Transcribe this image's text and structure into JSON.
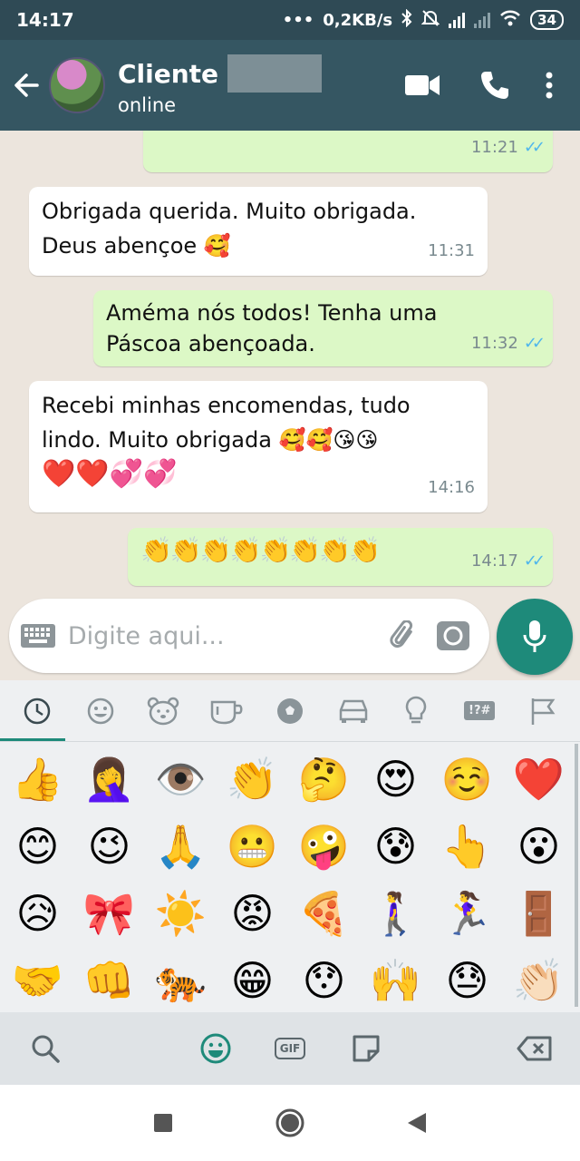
{
  "status_bar": {
    "time": "14:17",
    "network_speed": "0,2KB/s",
    "battery": "34"
  },
  "header": {
    "contact_name": "Cliente",
    "contact_status": "online"
  },
  "messages": [
    {
      "direction": "out",
      "text": "",
      "time": "11:21",
      "read": true
    },
    {
      "direction": "in",
      "text": "Obrigada querida. Muito obrigada.",
      "text2": "Deus abençoe 🥰",
      "time": "11:31"
    },
    {
      "direction": "out",
      "text": "Améma nós todos! Tenha uma",
      "text2": "Páscoa abençoada.",
      "time": "11:32",
      "read": true
    },
    {
      "direction": "in",
      "text": "Recebi minhas encomendas,  tudo",
      "text2": "lindo.  Muito obrigada 🥰🥰😘😘",
      "text3": "❤️❤️💞💞",
      "time": "14:16"
    },
    {
      "direction": "out",
      "text": "👏👏👏👏👏👏👏👏",
      "time": "14:17",
      "read": true
    }
  ],
  "composer": {
    "placeholder": "Digite aqui..."
  },
  "emoji_keyboard": {
    "categories": [
      "recent-icon",
      "smiley-icon",
      "animal-icon",
      "cup-icon",
      "ball-icon",
      "car-icon",
      "bulb-icon",
      "symbols-icon",
      "flag-icon"
    ],
    "symbols_label": "!?#",
    "recent_emojis": [
      "👍",
      "🤦‍♀️",
      "👁️",
      "👏",
      "🤔",
      "😍",
      "☺️",
      "❤️",
      "😊",
      "😉",
      "🙏",
      "😬",
      "🤪",
      "😰",
      "👆",
      "😮",
      "😥",
      "🎀",
      "☀️",
      "😡",
      "🍕",
      "🚶‍♀️",
      "🏃‍♀️",
      "🚪",
      "🤝",
      "👊",
      "🐅",
      "😁",
      "😯",
      "🙌",
      "😓",
      "👏🏻"
    ],
    "gif_label": "GIF"
  },
  "colors": {
    "header": "#355662",
    "outgoing_bubble": "#dcf8c6",
    "incoming_bubble": "#ffffff",
    "accent": "#1e8a7a",
    "read_ticks": "#4fb6ec"
  }
}
